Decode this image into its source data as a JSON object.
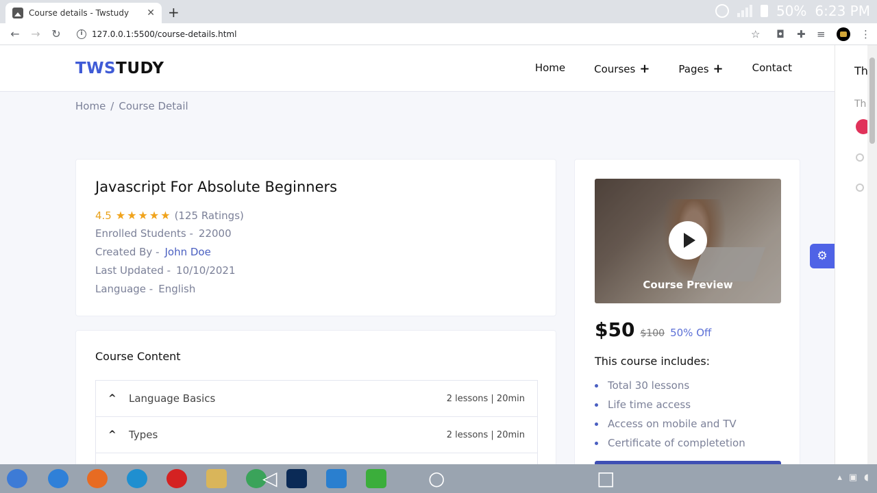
{
  "browser": {
    "tab_title": "Course details - Twstudy",
    "tab_close": "✕",
    "new_tab": "+",
    "url": "127.0.0.1:5500/course-details.html",
    "battery": "50%",
    "time": "6:23 PM"
  },
  "site": {
    "logo_part1": "TWS",
    "logo_part2": "TUDY",
    "nav": {
      "home": "Home",
      "courses": "Courses",
      "pages": "Pages",
      "contact": "Contact",
      "plus": "+"
    },
    "breadcrumb": {
      "home": "Home",
      "sep": "/",
      "current": "Course Detail"
    }
  },
  "course": {
    "title": "Javascript For Absolute Beginners",
    "rating_value": "4.5",
    "stars": "★★★★★",
    "rating_count": "(125 Ratings)",
    "enrolled_label": "Enrolled Students -",
    "enrolled_value": "22000",
    "created_label": "Created By -",
    "created_value": "John Doe",
    "updated_label": "Last Updated -",
    "updated_value": "10/10/2021",
    "language_label": "Language -",
    "language_value": "English"
  },
  "content": {
    "title": "Course Content",
    "sections": [
      {
        "name": "Language Basics",
        "meta": "2 lessons | 20min"
      },
      {
        "name": "Types",
        "meta": "2 lessons | 20min"
      }
    ]
  },
  "sidebar": {
    "preview_label": "Course Preview",
    "price_now": "$50",
    "price_old": "$100",
    "discount": "50% Off",
    "includes_title": "This course includes:",
    "includes": [
      "Total 30 lessons",
      "Life time access",
      "Access on mobile and TV",
      "Certificate of completetion"
    ]
  },
  "peek_panel": {
    "text1": "Th",
    "text2": "Th"
  },
  "colors": {
    "accent": "#3f5bd6",
    "star": "#f0a31c",
    "button": "#3f4fb4"
  }
}
